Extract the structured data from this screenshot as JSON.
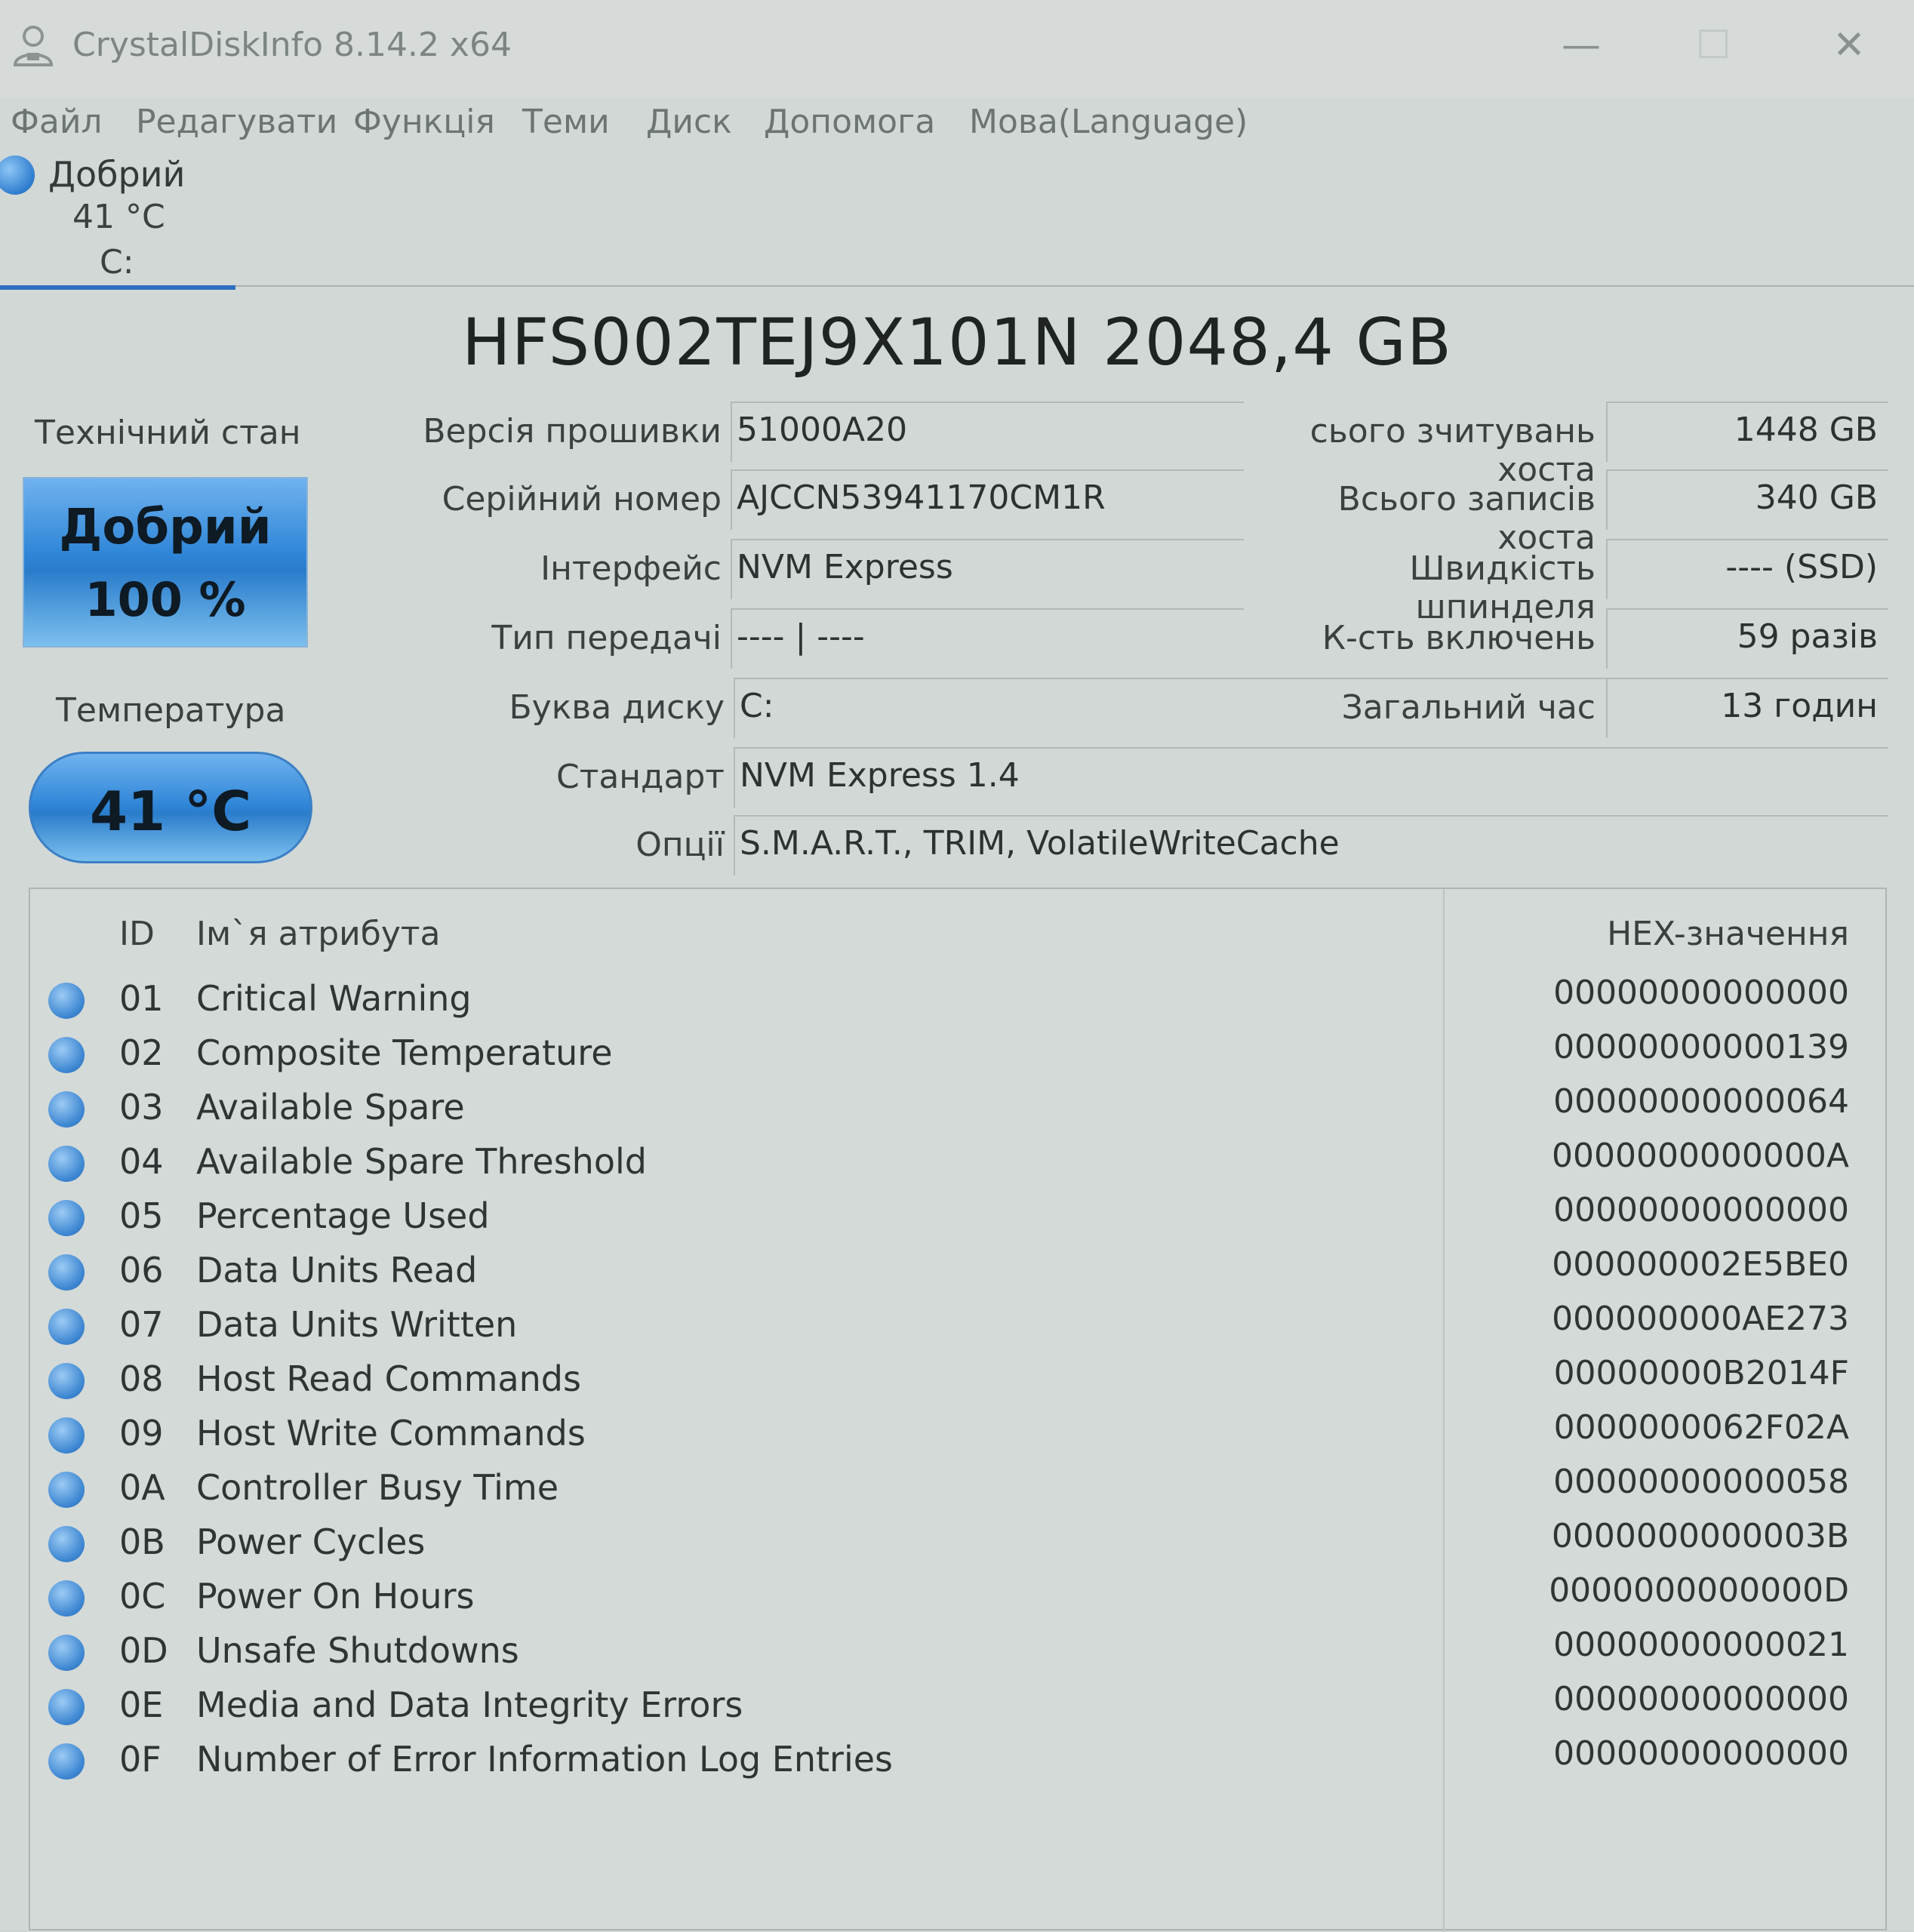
{
  "window": {
    "title": "CrystalDiskInfo 8.14.2 x64",
    "controls": {
      "minimize": "—",
      "maximize": "☐",
      "close": "✕"
    }
  },
  "menu": [
    "Файл",
    "Редагувати",
    "Функція",
    "Теми",
    "Диск",
    "Допомога",
    "Мова(Language)"
  ],
  "drive_tab": {
    "status": "Добрий",
    "temperature": "41 °C",
    "letter": "C:"
  },
  "model": "HFS002TEJ9X101N 2048,4 GB",
  "health": {
    "label": "Технічний стан",
    "status": "Добрий",
    "percent": "100 %"
  },
  "temperature": {
    "label": "Температура",
    "value": "41 °C"
  },
  "info": {
    "firmware": {
      "label": "Версія прошивки",
      "value": "51000A20"
    },
    "serial": {
      "label": "Серійний номер",
      "value": "AJCCN53941170CM1R"
    },
    "interface": {
      "label": "Інтерфейс",
      "value": "NVM Express"
    },
    "transfer": {
      "label": "Тип передачі",
      "value": "---- | ----"
    },
    "drive_letter": {
      "label": "Буква диску",
      "value": "C:"
    },
    "standard": {
      "label": "Стандарт",
      "value": "NVM Express 1.4"
    },
    "features": {
      "label": "Опції",
      "value": "S.M.A.R.T., TRIM, VolatileWriteCache"
    },
    "host_reads": {
      "label": "сього зчитувань хоста",
      "value": "1448 GB"
    },
    "host_writes": {
      "label": "Всього записів хоста",
      "value": "340 GB"
    },
    "rotation": {
      "label": "Швидкість шпинделя",
      "value": "---- (SSD)"
    },
    "power_count": {
      "label": "К-сть включень",
      "value": "59 разів"
    },
    "power_hours": {
      "label": "Загальний час",
      "value": "13 годин"
    }
  },
  "smart": {
    "headers": {
      "id": "ID",
      "name": "Ім`я атрибута",
      "hex": "HEX-значення"
    },
    "rows": [
      {
        "id": "01",
        "name": "Critical Warning",
        "hex": "00000000000000"
      },
      {
        "id": "02",
        "name": "Composite Temperature",
        "hex": "00000000000139"
      },
      {
        "id": "03",
        "name": "Available Spare",
        "hex": "00000000000064"
      },
      {
        "id": "04",
        "name": "Available Spare Threshold",
        "hex": "0000000000000A"
      },
      {
        "id": "05",
        "name": "Percentage Used",
        "hex": "00000000000000"
      },
      {
        "id": "06",
        "name": "Data Units Read",
        "hex": "000000002E5BE0"
      },
      {
        "id": "07",
        "name": "Data Units Written",
        "hex": "000000000AE273"
      },
      {
        "id": "08",
        "name": "Host Read Commands",
        "hex": "00000000B2014F"
      },
      {
        "id": "09",
        "name": "Host Write Commands",
        "hex": "0000000062F02A"
      },
      {
        "id": "0A",
        "name": "Controller Busy Time",
        "hex": "00000000000058"
      },
      {
        "id": "0B",
        "name": "Power Cycles",
        "hex": "0000000000003B"
      },
      {
        "id": "0C",
        "name": "Power On Hours",
        "hex": "0000000000000D"
      },
      {
        "id": "0D",
        "name": "Unsafe Shutdowns",
        "hex": "00000000000021"
      },
      {
        "id": "0E",
        "name": "Media and Data Integrity Errors",
        "hex": "00000000000000"
      },
      {
        "id": "0F",
        "name": "Number of Error Information Log Entries",
        "hex": "00000000000000"
      }
    ]
  },
  "colors": {
    "good_blue": "#2f86d8",
    "background": "#d2d8d6"
  }
}
